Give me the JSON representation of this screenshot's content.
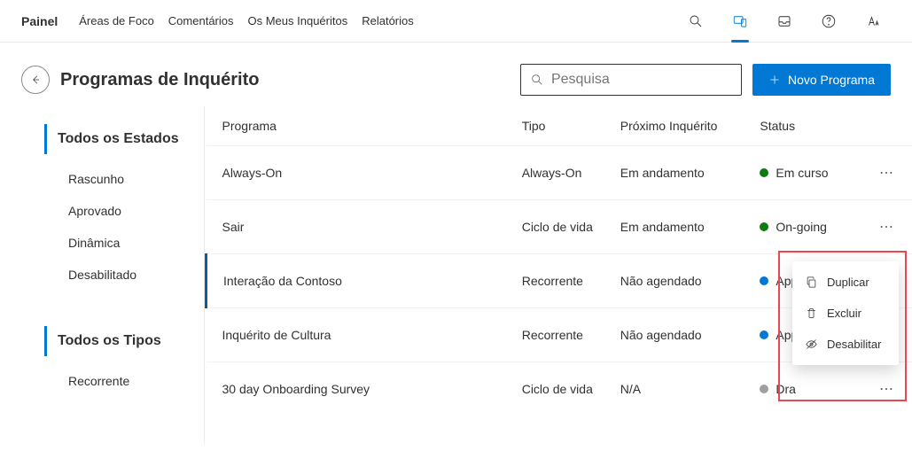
{
  "nav": {
    "brand": "Painel",
    "links": [
      "Áreas de Foco",
      "Comentários",
      "Os Meus Inquéritos",
      "Relatórios"
    ]
  },
  "page": {
    "title": "Programas de Inquérito",
    "search_placeholder": "Pesquisa",
    "new_program_label": "Novo Programa"
  },
  "sidebar": {
    "states_title": "Todos os Estados",
    "states": [
      "Rascunho",
      "Aprovado",
      "Dinâmica",
      "Desabilitado"
    ],
    "types_title": "Todos os Tipos",
    "types": [
      "Recorrente"
    ]
  },
  "table": {
    "headers": {
      "program": "Programa",
      "type": "Tipo",
      "next": "Próximo Inquérito",
      "status": "Status"
    },
    "rows": [
      {
        "program": "Always-On",
        "type": "Always-On",
        "next": "Em andamento",
        "status": "Em curso",
        "status_color": "green"
      },
      {
        "program": "Sair",
        "type": "Ciclo de vida",
        "next": "Em andamento",
        "status": "On-going",
        "status_color": "green"
      },
      {
        "program": "Interação da Contoso",
        "type": "Recorrente",
        "next": "Não agendado",
        "status": "Approve",
        "status_color": "blue",
        "selected": true
      },
      {
        "program": "Inquérito de Cultura",
        "type": "Recorrente",
        "next": "Não agendado",
        "status": "App",
        "status_color": "blue"
      },
      {
        "program": "30 day Onboarding Survey",
        "type": "Ciclo de vida",
        "next": "N/A",
        "status": "Dra",
        "status_color": "gray"
      }
    ]
  },
  "context_menu": {
    "duplicate": "Duplicar",
    "delete": "Excluir",
    "disable": "Desabilitar"
  }
}
